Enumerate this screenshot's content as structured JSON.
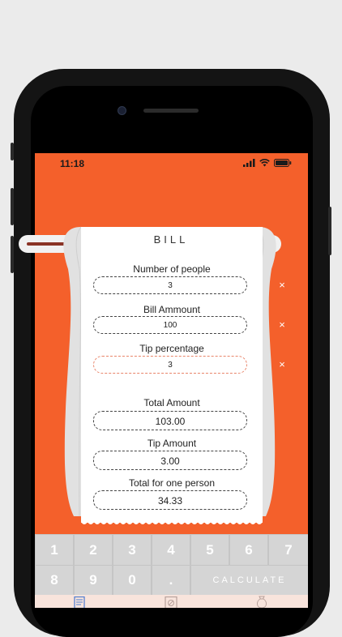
{
  "status": {
    "time": "11:18"
  },
  "bill": {
    "title": "BILL",
    "people_label": "Number of people",
    "people_value": "3",
    "amount_label": "Bill Ammount",
    "amount_value": "100",
    "tip_label": "Tip percentage",
    "tip_value": "3",
    "clear_glyph": "×"
  },
  "results": {
    "total_label": "Total Amount",
    "total_value": "103.00",
    "tip_label": "Tip Amount",
    "tip_value": "3.00",
    "per_person_label": "Total for one person",
    "per_person_value": "34.33"
  },
  "keypad": {
    "keys": [
      "1",
      "2",
      "3",
      "4",
      "5",
      "6",
      "7",
      "8",
      "9",
      "0",
      "."
    ],
    "calculate": "CALCULATE"
  },
  "tabs": [
    {
      "icon": "receipt-icon"
    },
    {
      "icon": "no-tip-icon"
    },
    {
      "icon": "money-bag-icon"
    }
  ],
  "colors": {
    "accent": "#f4602b",
    "roll": "#8a3325",
    "keypad": "#c5c5c5"
  }
}
